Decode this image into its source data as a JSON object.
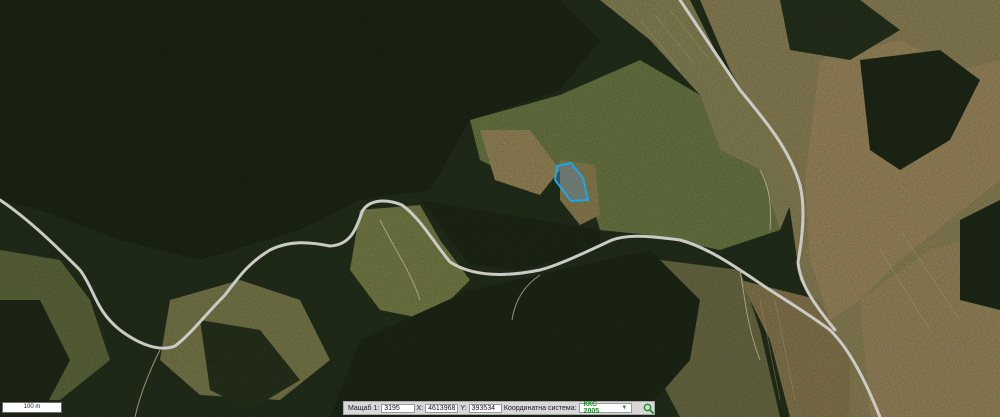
{
  "scale_bar": {
    "label": "100 m"
  },
  "coordinates": {
    "scale_label": "Мащаб 1:",
    "scale_value": "3195",
    "x_label": "X:",
    "x_value": "4613968",
    "y_label": "Y:",
    "y_value": "393534",
    "system_label": "Координатна система:",
    "system_value": "ККС 2005"
  },
  "icons": {
    "dropdown": "chevron-down-icon",
    "search": "magnifier-icon"
  },
  "colors": {
    "parcel_outline": "#19a9e6",
    "road": "#c9cbc4",
    "forest": "#1f2a17"
  }
}
